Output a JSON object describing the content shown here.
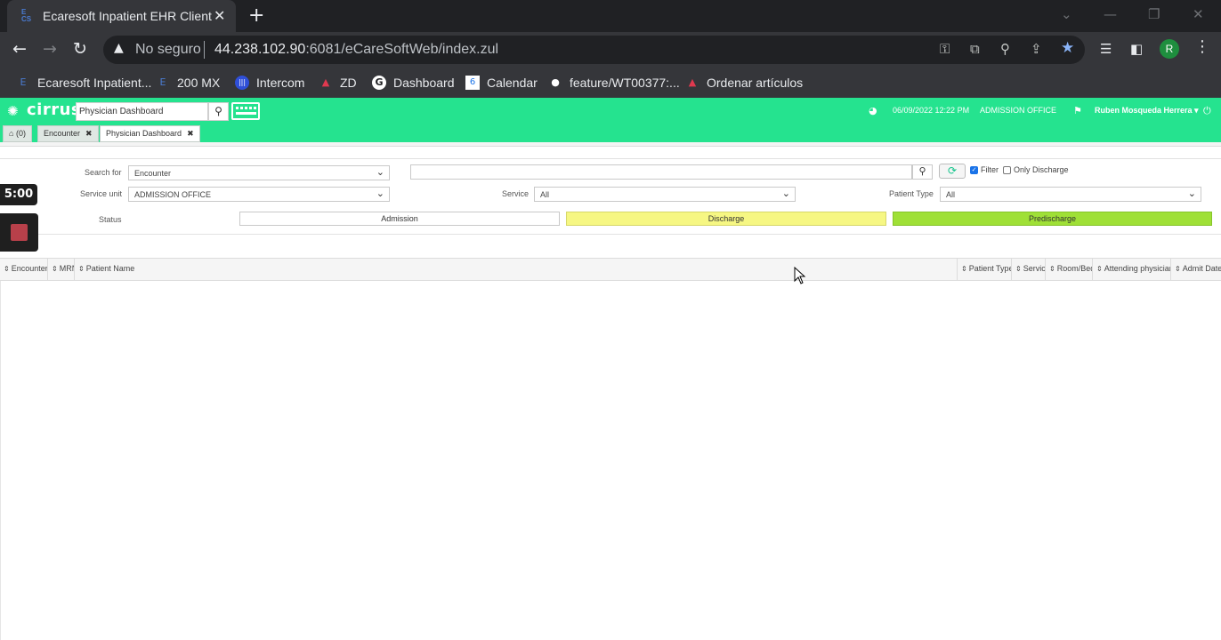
{
  "browser": {
    "tab_title": "Ecaresoft Inpatient EHR Client",
    "tab_favicon_text": "E CS",
    "new_tab": "+",
    "security_label": "No seguro",
    "url_host": "44.238.102.90",
    "url_rest": ":6081/eCareSoftWeb/index.zul",
    "profile_initial": "R",
    "bookmarks": [
      {
        "label": "Ecaresoft Inpatient...",
        "icon": "ecaresoft-icon",
        "glyph": "E",
        "color": "#4a7bd0"
      },
      {
        "label": "200 MX",
        "icon": "ecaresoft-icon",
        "glyph": "E",
        "color": "#4a7bd0"
      },
      {
        "label": "Intercom",
        "icon": "intercom-icon",
        "glyph": "|||",
        "color": "#ffffff"
      },
      {
        "label": "ZD",
        "icon": "zendesk-icon",
        "glyph": "▲",
        "color": "#e0394f"
      },
      {
        "label": "Dashboard",
        "icon": "google-icon",
        "glyph": "G",
        "color": "#ffffff"
      },
      {
        "label": "Calendar",
        "icon": "calendar-icon",
        "glyph": "6",
        "color": "#1a73e8"
      },
      {
        "label": "feature/WT00377:...",
        "icon": "github-icon",
        "glyph": "●",
        "color": "#ffffff"
      },
      {
        "label": "Ordenar artículos",
        "icon": "zendesk-icon",
        "glyph": "▲",
        "color": "#e0394f"
      }
    ]
  },
  "app": {
    "logo": "cirrus",
    "search_value": "Physician Dashboard",
    "datetime": "06/09/2022 12:22 PM",
    "office": "ADMISSION OFFICE",
    "user": "Ruben Mosqueda Herrera",
    "user_caret": "▾",
    "tabs": {
      "home": "(0)",
      "encounter": "Encounter",
      "physician_dashboard": "Physician Dashboard",
      "close": "✖"
    },
    "accent_color": "#25e38f"
  },
  "filters": {
    "search_for_label": "Search for",
    "search_for_value": "Encounter",
    "service_unit_label": "Service unit",
    "service_unit_value": "ADMISSION OFFICE",
    "service_label": "Service",
    "service_value": "All",
    "patient_type_label": "Patient Type",
    "patient_type_value": "All",
    "search_text_value": "",
    "filter_label": "Filter",
    "filter_checked": true,
    "only_discharge_label": "Only Discharge",
    "only_discharge_checked": false,
    "status_label": "Status",
    "status_buttons": [
      {
        "label": "Admission",
        "color": "#ffffff"
      },
      {
        "label": "Discharge",
        "color": "#f6f783"
      },
      {
        "label": "Predischarge",
        "color": "#9fe036"
      }
    ]
  },
  "grid": {
    "columns": [
      "Encounter",
      "MRN",
      "Patient Name",
      "Patient Type",
      "Service",
      "Room/Bed",
      "Attending physician",
      "Admit Date"
    ],
    "rows": []
  },
  "recorder": {
    "timer": "5:00"
  }
}
